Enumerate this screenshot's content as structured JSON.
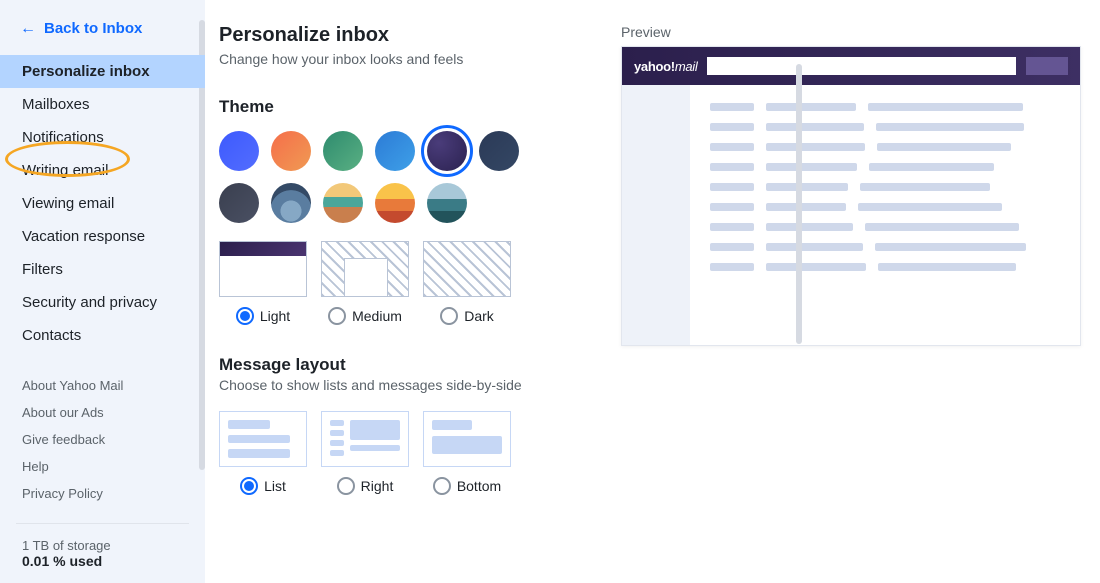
{
  "back_label": "Back to Inbox",
  "sidebar": {
    "items": [
      {
        "label": "Personalize inbox",
        "active": true
      },
      {
        "label": "Mailboxes"
      },
      {
        "label": "Notifications"
      },
      {
        "label": "Writing email",
        "annotated": true
      },
      {
        "label": "Viewing email"
      },
      {
        "label": "Vacation response"
      },
      {
        "label": "Filters"
      },
      {
        "label": "Security and privacy"
      },
      {
        "label": "Contacts"
      }
    ],
    "meta": [
      {
        "label": "About Yahoo Mail"
      },
      {
        "label": "About our Ads"
      },
      {
        "label": "Give feedback"
      },
      {
        "label": "Help"
      },
      {
        "label": "Privacy Policy"
      }
    ],
    "storage": {
      "line1": "1 TB of storage",
      "line2": "0.01 % used"
    }
  },
  "page": {
    "title": "Personalize inbox",
    "subtitle": "Change how your inbox looks and feels"
  },
  "theme": {
    "heading": "Theme",
    "swatches": [
      {
        "name": "blue",
        "css": "linear-gradient(135deg,#3d5afe,#536dfe)"
      },
      {
        "name": "orange",
        "css": "linear-gradient(135deg,#f56e4a,#f09a53)"
      },
      {
        "name": "green",
        "css": "linear-gradient(135deg,#2e8b6e,#5ab083)"
      },
      {
        "name": "sky",
        "css": "linear-gradient(135deg,#2c7bd6,#3ea0e8)"
      },
      {
        "name": "indigo",
        "css": "radial-gradient(circle at 30% 30%,#4a3c7a,#2b2250)",
        "selected": true
      },
      {
        "name": "navy",
        "css": "linear-gradient(135deg,#2b3a57,#344764)"
      },
      {
        "name": "charcoal",
        "css": "linear-gradient(135deg,#3a3f4f,#4a5063)"
      },
      {
        "name": "mountains",
        "css": "radial-gradient(circle at 50% 70%,#86a8c5 30%,#5a7da0 31% 60%,#344a66 61%)"
      },
      {
        "name": "beach",
        "css": "linear-gradient(#f2c879 0 35%,#4aa69a 35% 60%,#c97f4d 60%)"
      },
      {
        "name": "sunset",
        "css": "linear-gradient(#f9c34a 0 40%,#e87a3a 40% 70%,#c44a2e 70%)"
      },
      {
        "name": "river",
        "css": "linear-gradient(#a8c8d8 0 40%,#3a7b86 40% 70%,#22535b 70%)"
      }
    ],
    "density": [
      {
        "label": "Light",
        "selected": true
      },
      {
        "label": "Medium"
      },
      {
        "label": "Dark"
      }
    ]
  },
  "layout": {
    "heading": "Message layout",
    "subtitle": "Choose to show lists and messages side-by-side",
    "options": [
      {
        "label": "List",
        "selected": true
      },
      {
        "label": "Right"
      },
      {
        "label": "Bottom"
      }
    ]
  },
  "preview": {
    "label": "Preview",
    "logo_a": "yahoo!",
    "logo_b": "mail"
  }
}
